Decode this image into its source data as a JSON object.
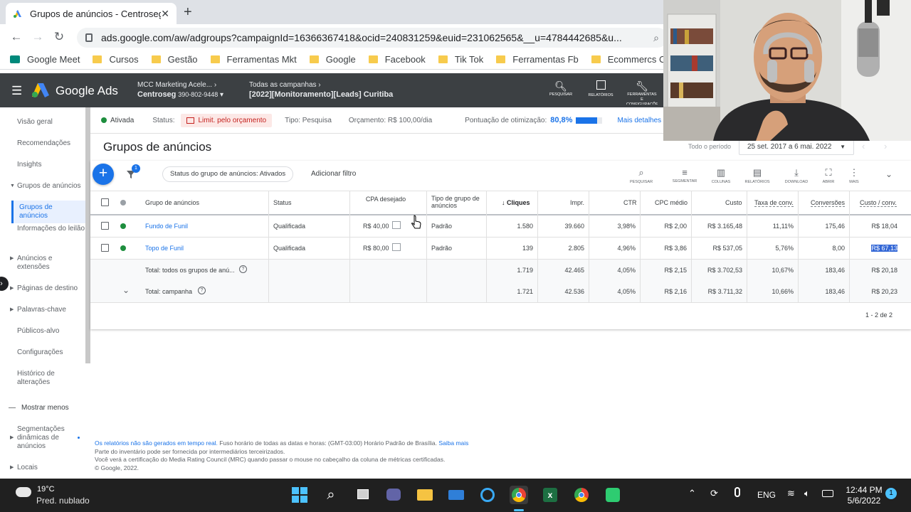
{
  "browser": {
    "tab_title": "Grupos de anúncios - Centroseg",
    "url": "ads.google.com/aw/adgroups?campaignId=16366367418&ocid=240831259&euid=231062565&__u=4784442685&u..."
  },
  "bookmarks": [
    "Google Meet",
    "Cursos",
    "Gestão",
    "Ferramentas Mkt",
    "Google",
    "Facebook",
    "Tik Tok",
    "Ferramentas Fb",
    "Ecommercs Clientes"
  ],
  "ads_header": {
    "product": "Google Ads",
    "account_parent": "MCC Marketing Acele...",
    "account_name": "Centroseg",
    "account_id": "390-802-9448",
    "campaign_parent": "Todas as campanhas",
    "campaign_name": "[2022][Monitoramento][Leads] Curitiba",
    "tools": [
      {
        "icon": "search-icon",
        "label": "PESQUISAR"
      },
      {
        "icon": "reports-icon",
        "label": "RELATÓRIOS"
      },
      {
        "icon": "wrench-icon",
        "label": "FERRAMENTAS E CONFIGURAÇÕES"
      }
    ]
  },
  "sidebar": {
    "items": [
      "Visão geral",
      "Recomendações",
      "Insights",
      "Grupos de anúncios",
      "Grupos de anúncios",
      "Informações do leilão",
      "Anúncios e extensões",
      "Páginas de destino",
      "Palavras-chave",
      "Públicos-alvo",
      "Configurações",
      "Histórico de alterações",
      "Mostrar menos",
      "Segmentações dinâmicas de anúncios",
      "Locais"
    ]
  },
  "statusbar": {
    "state": "Ativada",
    "status_label": "Status:",
    "status_value": "Limit. pelo orçamento",
    "type": "Tipo: Pesquisa",
    "budget": "Orçamento: R$ 100,00/dia",
    "score_label": "Pontuação de otimização:",
    "score_value": "80,8%",
    "score_fraction": 0.808,
    "details": "Mais detalhes"
  },
  "page": {
    "title": "Grupos de anúncios",
    "period_label": "Todo o período",
    "date_range": "25 set. 2017 a 6 mai. 2022"
  },
  "filters": {
    "count": "1",
    "chip": "Status do grupo de anúncios: Ativados",
    "add": "Adicionar filtro"
  },
  "table_tools": [
    "PESQUISAR",
    "SEGMENTAR",
    "COLUNAS",
    "RELATÓRIOS",
    "DOWNLOAD",
    "ABRIR",
    "MAIS"
  ],
  "table": {
    "headers": [
      "Grupo de anúncios",
      "Status",
      "CPA desejado",
      "Tipo de grupo de anúncios",
      "Cliques",
      "Impr.",
      "CTR",
      "CPC médio",
      "Custo",
      "Taxa de conv.",
      "Conversões",
      "Custo / conv."
    ],
    "rows": [
      [
        "Fundo de Funil",
        "Qualificada",
        "R$ 40,00",
        "Padrão",
        "1.580",
        "39.660",
        "3,98%",
        "R$ 2,00",
        "R$ 3.165,48",
        "11,11%",
        "175,46",
        "R$ 18,04"
      ],
      [
        "Topo de Funil",
        "Qualificada",
        "R$ 80,00",
        "Padrão",
        "139",
        "2.805",
        "4,96%",
        "R$ 3,86",
        "R$ 537,05",
        "5,76%",
        "8,00",
        "R$ 67,13"
      ]
    ],
    "totals": [
      [
        "Total: todos os grupos de anú...",
        "1.719",
        "42.465",
        "4,05%",
        "R$ 2,15",
        "R$ 3.702,53",
        "10,67%",
        "183,46",
        "R$ 20,18"
      ],
      [
        "Total: campanha",
        "1.721",
        "42.536",
        "4,05%",
        "R$ 2,16",
        "R$ 3.711,32",
        "10,66%",
        "183,46",
        "R$ 20,23"
      ]
    ],
    "pagination": "1 - 2 de 2"
  },
  "footer": {
    "line1_link": "Os relatórios não são gerados em tempo real.",
    "line1_rest": "Fuso horário de todas as datas e horas: (GMT-03:00) Horário Padrão de Brasília.",
    "line1_more": "Saiba mais",
    "line2": "Parte do inventário pode ser fornecida por intermediários terceirizados.",
    "line3": "Você verá a certificação do Media Rating Council (MRC) quando passar o mouse no cabeçalho da coluna de métricas certificadas.",
    "copyright": "© Google, 2022."
  },
  "taskbar": {
    "temp": "19°C",
    "weather": "Pred. nublado",
    "lang": "ENG",
    "time": "12:44 PM",
    "date": "5/6/2022",
    "notif": "1"
  }
}
